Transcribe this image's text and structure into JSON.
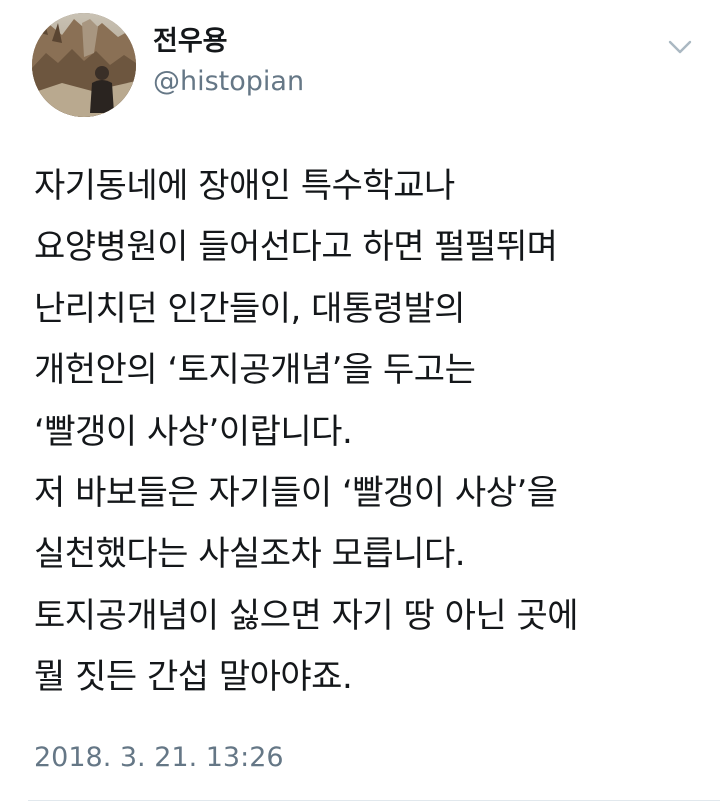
{
  "tweet": {
    "author": {
      "display_name": "전우용",
      "handle": "@histopian"
    },
    "menu_icon": "chevron-down-icon",
    "lines": [
      "자기동네에 장애인 특수학교나",
      "요양병원이 들어선다고 하면 펄펄뛰며",
      "난리치던 인간들이, 대통령발의",
      "개헌안의 ‘토지공개념’을 두고는",
      "‘빨갱이 사상’이랍니다.",
      "저 바보들은 자기들이 ‘빨갱이 사상’을",
      "실천했다는 사실조차 모릅니다.",
      "토지공개념이 싫으면 자기 땅 아닌 곳에",
      "뭘 짓든 간섭 말아야죠."
    ],
    "timestamp": "2018. 3. 21. 13:26"
  },
  "colors": {
    "text_primary": "#14171a",
    "text_secondary": "#657786",
    "divider": "#e1e8ed",
    "caret": "#aab8c2"
  }
}
